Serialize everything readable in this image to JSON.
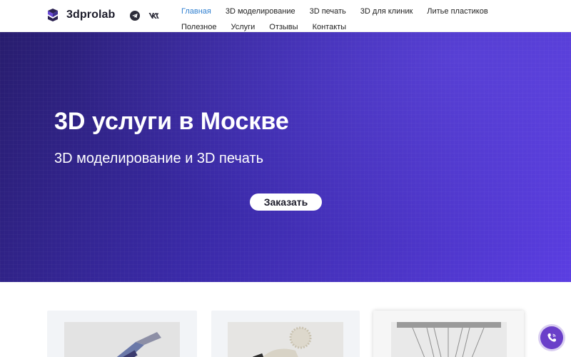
{
  "brand": {
    "name": "3dprolab"
  },
  "social": [
    {
      "icon": "telegram-icon"
    },
    {
      "icon": "vk-icon"
    }
  ],
  "nav": {
    "row1": [
      "Главная",
      "3D моделирование",
      "3D печать",
      "3D для клиник",
      "Литье пластиков"
    ],
    "row2": [
      "Полезное",
      "Услуги",
      "Отзывы",
      "Контакты"
    ],
    "active": "Главная"
  },
  "hero": {
    "title": "3D услуги в Москве",
    "subtitle": "3D моделирование и 3D печать",
    "button": "Заказать"
  },
  "colors": {
    "accent": "#5b3ee2",
    "nav_active": "#2f7fd0",
    "call_button": "#6a3fc9"
  }
}
